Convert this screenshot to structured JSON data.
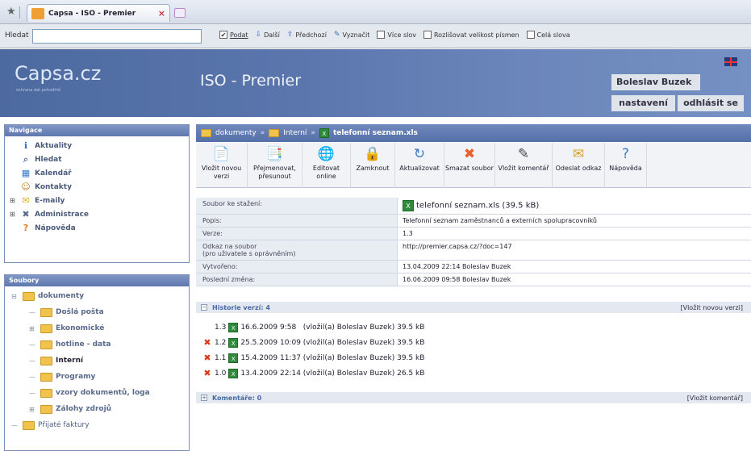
{
  "browser": {
    "tab_title": "Capsa - ISO - Premier",
    "find_label": "Hledat",
    "find_value": "",
    "find_options": [
      {
        "label": "Podat",
        "checked": true,
        "icon": "check-icon",
        "underline": true
      },
      {
        "label": "Další",
        "checked": null,
        "icon": "arrow-down-icon"
      },
      {
        "label": "Předchozí",
        "checked": null,
        "icon": "arrow-up-icon"
      },
      {
        "label": "Vyznačit",
        "checked": null,
        "icon": "highlight-icon"
      },
      {
        "label": "Více slov",
        "checked": false
      },
      {
        "label": "Rozlišovat velikost písmen",
        "checked": false
      },
      {
        "label": "Celá slova",
        "checked": false
      }
    ]
  },
  "header": {
    "logo": "Capsa.cz",
    "tagline": "ochrana dat pohodlně",
    "site_title": "ISO - Premier",
    "user_name": "Boleslav Buzek",
    "settings_label": "nastavení",
    "logout_label": "odhlásit se"
  },
  "navigation": {
    "title": "Navigace",
    "items": [
      {
        "label": "Aktuality",
        "icon": "info-icon",
        "color": "#2a6ac0"
      },
      {
        "label": "Hledat",
        "icon": "search-icon",
        "color": "#5a7ab0"
      },
      {
        "label": "Kalendář",
        "icon": "calendar-icon",
        "color": "#3a7ac8"
      },
      {
        "label": "Kontakty",
        "icon": "contacts-icon",
        "color": "#c67a2a"
      },
      {
        "label": "E-maily",
        "icon": "envelope-icon",
        "color": "#e0b030",
        "expandable": true
      },
      {
        "label": "Administrace",
        "icon": "tools-icon",
        "color": "#5a6a8a",
        "expandable": true
      },
      {
        "label": "Nápověda",
        "icon": "help-icon",
        "color": "#e0802a"
      }
    ]
  },
  "files": {
    "title": "Soubory",
    "tree": [
      {
        "label": "dokumenty",
        "level": 0,
        "toggle": "-"
      },
      {
        "label": "Došlá pošta",
        "level": 1,
        "toggle": ""
      },
      {
        "label": "Ekonomické",
        "level": 1,
        "toggle": "+"
      },
      {
        "label": "hotline - data",
        "level": 1,
        "toggle": ""
      },
      {
        "label": "Interní",
        "level": 1,
        "toggle": "",
        "current": true
      },
      {
        "label": "Programy",
        "level": 1,
        "toggle": ""
      },
      {
        "label": "vzory dokumentů, loga",
        "level": 1,
        "toggle": ""
      },
      {
        "label": "Zálohy zdrojů",
        "level": 1,
        "toggle": "+"
      },
      {
        "label": "Přijaté faktury",
        "level": 0,
        "toggle": "",
        "plain": true
      }
    ]
  },
  "breadcrumb": {
    "items": [
      "dokumenty",
      "Interní"
    ],
    "separator": "»",
    "current": "telefonní seznam.xls"
  },
  "toolbar": [
    {
      "label": "Vložit novou verzi",
      "icon": "upload-icon",
      "width": 64,
      "glyph": "📄",
      "color": "#c33"
    },
    {
      "label": "Přejmenovat, přesunout",
      "icon": "rename-icon",
      "width": 68,
      "glyph": "📑",
      "color": "#2a8a3a"
    },
    {
      "label": "Editovat online",
      "icon": "edit-online-icon",
      "width": 60,
      "glyph": "🌐",
      "color": "#2a8a3a"
    },
    {
      "label": "Zamknout",
      "icon": "lock-icon",
      "width": 55,
      "glyph": "🔒",
      "color": "#c03020"
    },
    {
      "label": "Aktualizovat",
      "icon": "refresh-icon",
      "width": 61,
      "glyph": "↻",
      "color": "#3a7ac8"
    },
    {
      "label": "Smazat soubor",
      "icon": "delete-icon",
      "width": 63,
      "glyph": "✖",
      "color": "#e8602a"
    },
    {
      "label": "Vložit komentář",
      "icon": "comment-icon",
      "width": 71,
      "glyph": "✎",
      "color": "#445"
    },
    {
      "label": "Odeslat odkaz",
      "icon": "send-mail-icon",
      "width": 65,
      "glyph": "✉",
      "color": "#d8a020"
    },
    {
      "label": "Nápověda",
      "icon": "help-icon",
      "width": 52,
      "glyph": "?",
      "color": "#3a7ac8"
    }
  ],
  "properties": [
    {
      "key": "Soubor ke stažení:",
      "value": "telefonní seznam.xls (39.5 kB)",
      "xls": true
    },
    {
      "key": "Popis:",
      "value": "Telefonní seznam zaměstnanců a externích spolupracovníků"
    },
    {
      "key": "Verze:",
      "value": "1.3"
    },
    {
      "key": "Odkaz na soubor\n(pro uživatele s oprávněním)",
      "value": "http://premier.capsa.cz/?doc=147"
    },
    {
      "key": "Vytvořeno:",
      "value": "13.04.2009 22:14 Boleslav Buzek"
    },
    {
      "key": "Poslední změna:",
      "value": "16.06.2009 09:58 Boleslav Buzek"
    }
  ],
  "history": {
    "title": "Historie verzí: 4",
    "action": "[Vložit novou verzi]",
    "rows": [
      {
        "version": "1.3",
        "text": "16.6.2009 9:58   (vložil(a) Boleslav Buzek) 39.5 kB",
        "deletable": false
      },
      {
        "version": "1.2",
        "text": "25.5.2009 10:09 (vložil(a) Boleslav Buzek) 39.5 kB",
        "deletable": true
      },
      {
        "version": "1.1",
        "text": "15.4.2009 11:37 (vložil(a) Boleslav Buzek) 39.5 kB",
        "deletable": true
      },
      {
        "version": "1.0",
        "text": "13.4.2009 22:14 (vložil(a) Boleslav Buzek) 26.5 kB",
        "deletable": true
      }
    ]
  },
  "comments": {
    "title": "Komentáře: 0",
    "action": "[Vložit komentář]"
  }
}
